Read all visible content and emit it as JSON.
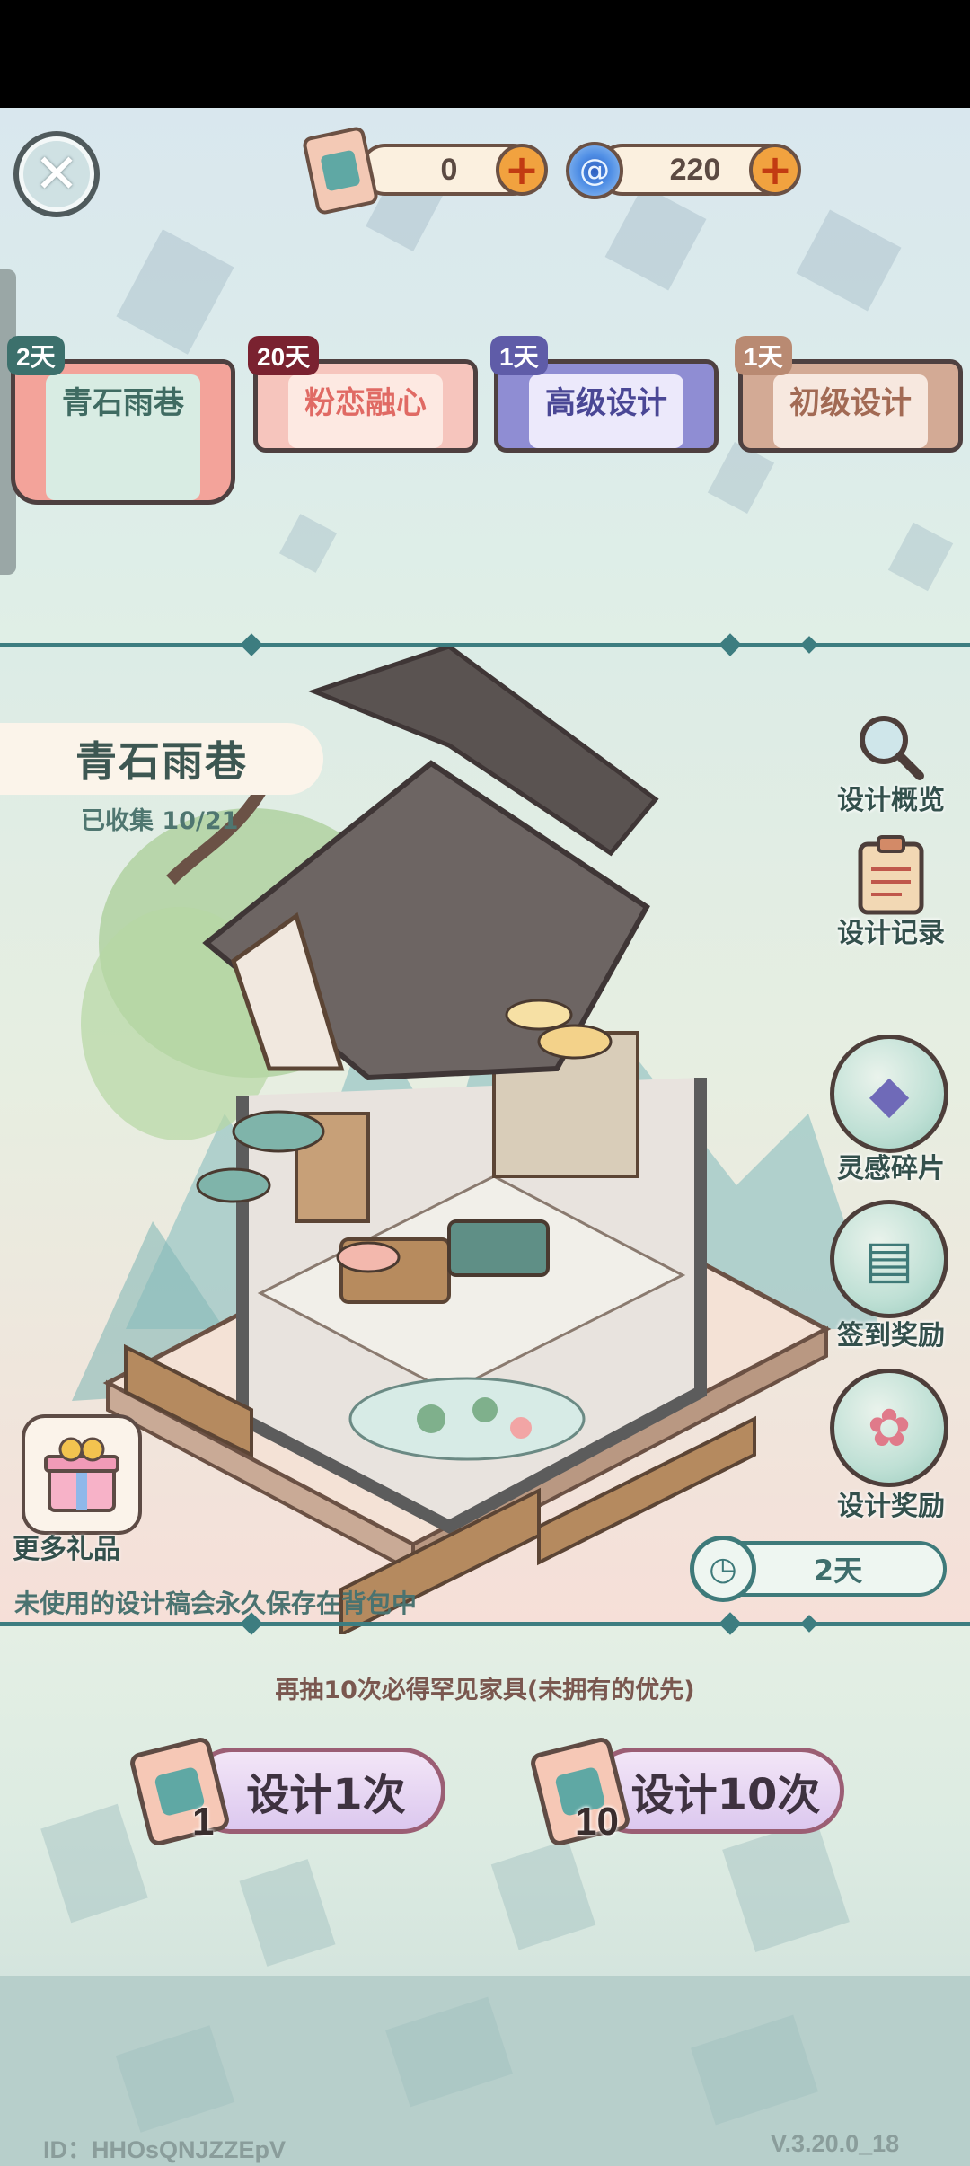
{
  "header": {
    "close_icon": "close-icon",
    "currencies": [
      {
        "icon": "design-scroll-icon",
        "value": "0"
      },
      {
        "icon": "swirl-gem-icon",
        "value": "220"
      }
    ]
  },
  "tabs": [
    {
      "badge": "2天",
      "label": "青石雨巷",
      "color": "#f3a39a"
    },
    {
      "badge": "20天",
      "label": "粉恋融心",
      "color": "#f6b4b0"
    },
    {
      "badge": "1天",
      "label": "高级设计",
      "color": "#8f8dd3"
    },
    {
      "badge": "1天",
      "label": "初级设计",
      "color": "#d3aa95"
    }
  ],
  "scene": {
    "title": "青石雨巷",
    "collected": "已收集 10/21"
  },
  "side_buttons": [
    {
      "icon": "magnifier-icon",
      "label": "设计概览"
    },
    {
      "icon": "clipboard-icon",
      "label": "设计记录"
    },
    {
      "icon": "inspiration-fragment-icon",
      "label": "灵感碎片"
    },
    {
      "icon": "calendar-pen-icon",
      "label": "签到奖励"
    },
    {
      "icon": "lotus-icon",
      "label": "设计奖励"
    }
  ],
  "gifts": {
    "icon": "gift-box-icon",
    "label": "更多礼品"
  },
  "timer": {
    "icon": "clock-icon",
    "value": "2天"
  },
  "save_note": "未使用的设计稿会永久保存在背包中",
  "hint": "再抽10次必得罕见家具(未拥有的优先)",
  "draw_buttons": [
    {
      "count": "1",
      "label": "设计1次"
    },
    {
      "count": "10",
      "label": "设计10次"
    }
  ],
  "footer": {
    "id": "ID：HHOsQNJZZEpV",
    "version": "V.3.20.0_18"
  }
}
